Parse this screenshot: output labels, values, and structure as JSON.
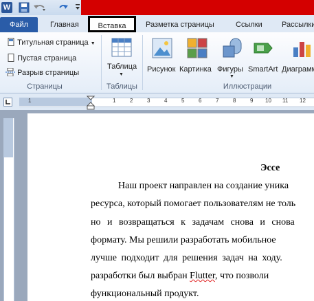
{
  "colors": {
    "file_tab": "#2a5ca8",
    "titlebar_accent": "#d40000",
    "ribbon_bg": "#e4edf8",
    "workspace": "#9aa8bc",
    "active_tab_border": "#000000"
  },
  "quick_access": {
    "app_icon": "W",
    "icons": [
      "word-logo-icon",
      "save-icon",
      "undo-icon",
      "redo-icon",
      "customize-qat-icon"
    ]
  },
  "tabs": {
    "file": "Файл",
    "home": "Главная",
    "insert": "Вставка",
    "page_layout": "Разметка страницы",
    "references": "Ссылки",
    "mailings": "Рассылки"
  },
  "ribbon": {
    "pages": {
      "cover_page": "Титульная страница",
      "blank_page": "Пустая страница",
      "page_break": "Разрыв страницы",
      "group": "Страницы"
    },
    "tables": {
      "table": "Таблица",
      "group": "Таблицы"
    },
    "illustrations": {
      "picture": "Рисунок",
      "clip_art": "Картинка",
      "shapes": "Фигуры",
      "smartart": "SmartArt",
      "chart": "Диаграмма",
      "group": "Иллюстрации"
    }
  },
  "ruler": {
    "marks": [
      "1",
      "1",
      "2",
      "3",
      "4",
      "5",
      "6",
      "7",
      "8",
      "9",
      "10",
      "11",
      "12",
      "13"
    ]
  },
  "document": {
    "title": "Эссе",
    "lines": [
      "Наш проект направлен на создание уника",
      "ресурса, который помогает пользователям не толь",
      "но и возвращаться к задачам снова и снова",
      "формату. Мы решили разработать мобильное",
      "лучше подходит для решения задач на ходу.",
      "разработки был выбран",
      "функциональный продукт."
    ],
    "line6_word": "Flutter",
    "line6_rest": ", что позволи"
  }
}
